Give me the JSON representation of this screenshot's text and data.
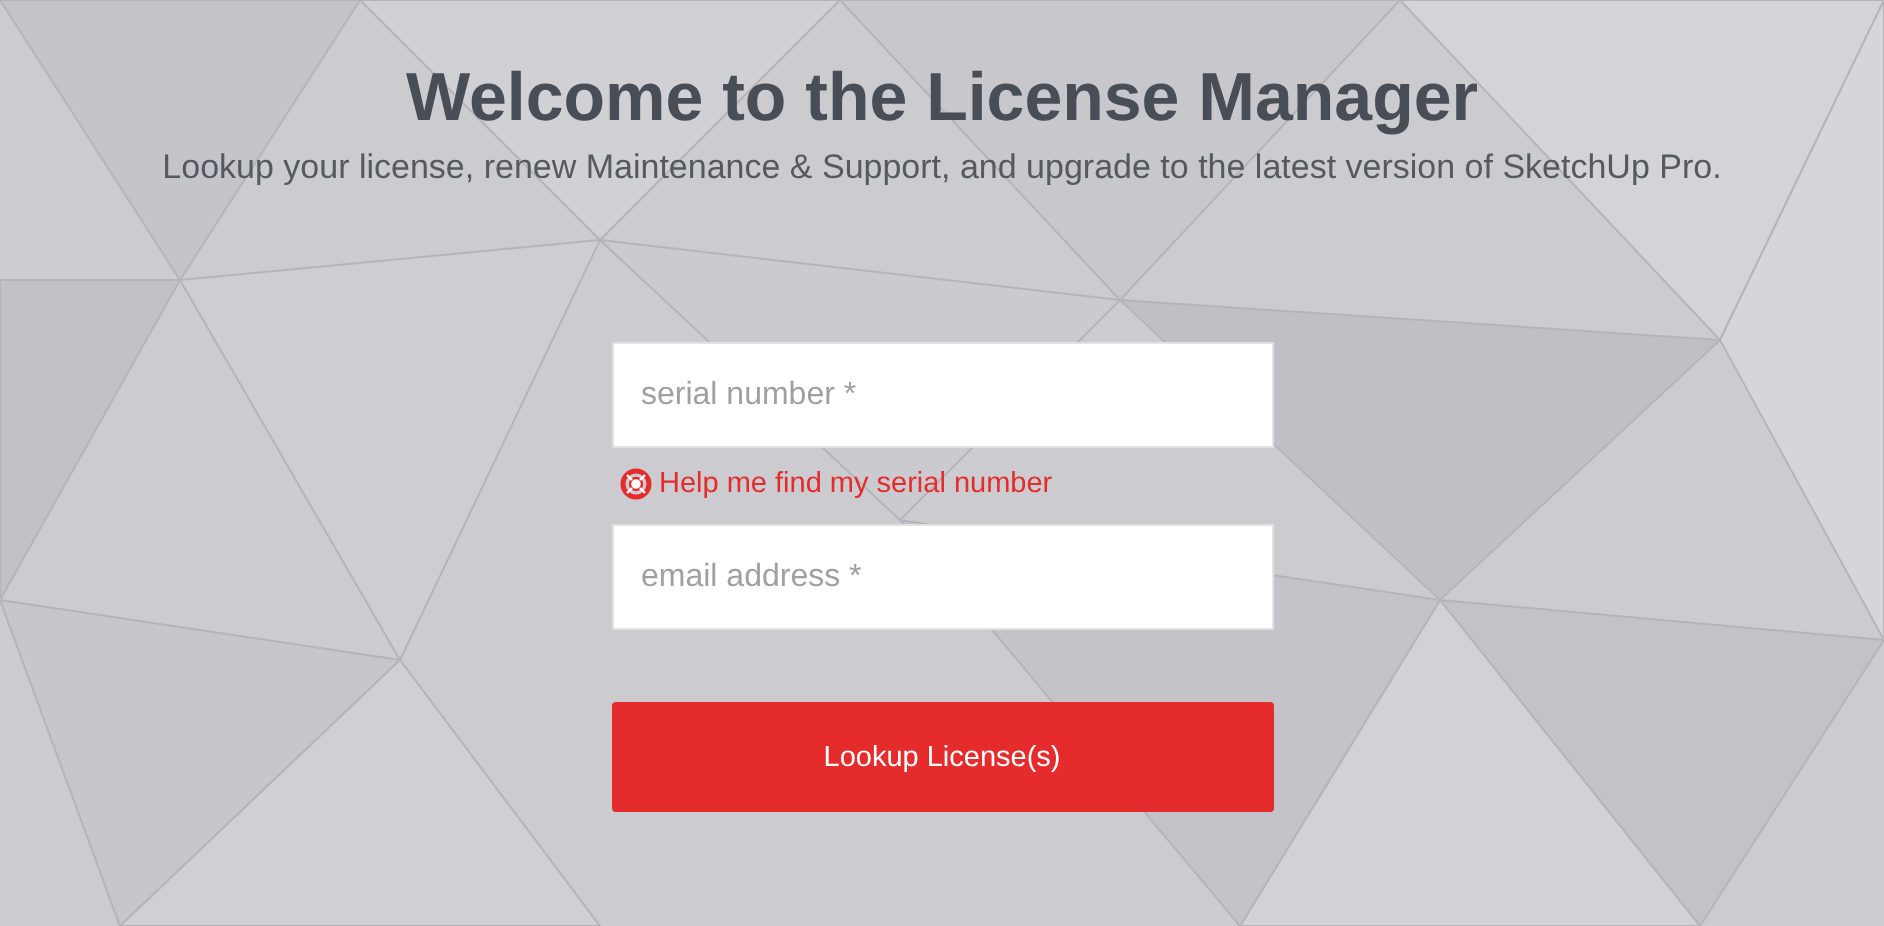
{
  "header": {
    "title": "Welcome to the License Manager",
    "subtitle": "Lookup your license, renew Maintenance & Support, and upgrade to the latest version of SketchUp Pro."
  },
  "form": {
    "serial_field": {
      "placeholder": "serial number *"
    },
    "help_link": "Help me find my serial number",
    "email_field": {
      "placeholder": "email address *"
    },
    "submit_button": "Lookup License(s)"
  }
}
